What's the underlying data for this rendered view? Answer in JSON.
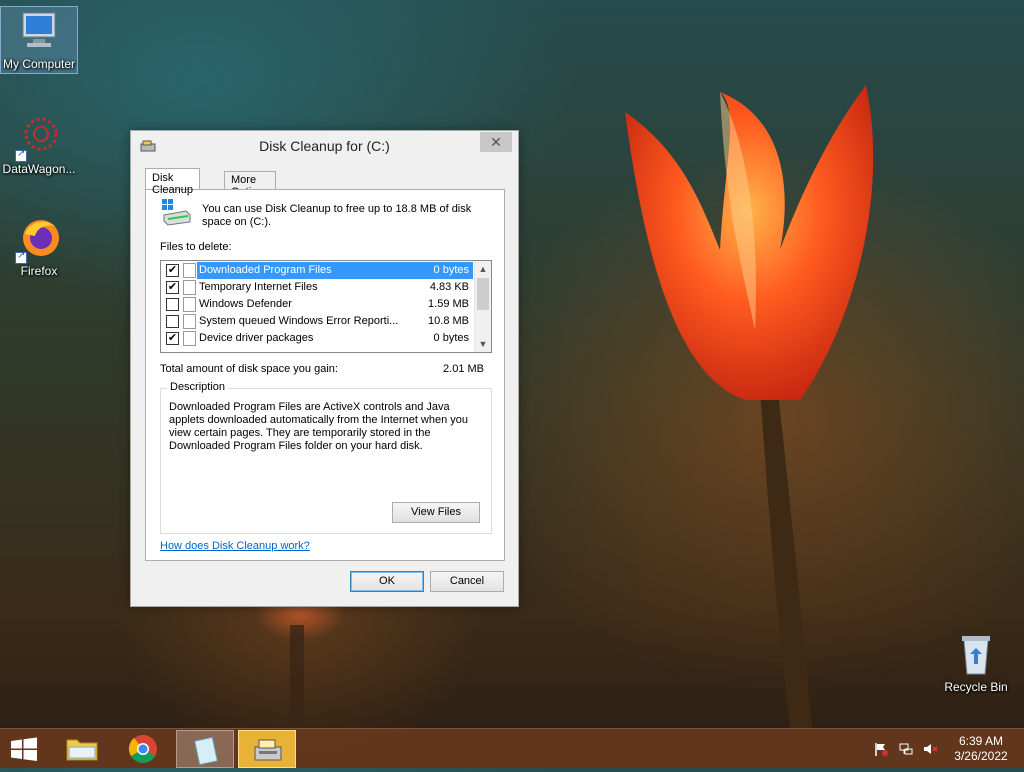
{
  "desktop": {
    "icons": [
      {
        "label": "My Computer"
      },
      {
        "label": "DataWagon..."
      },
      {
        "label": "Firefox"
      },
      {
        "label": "Recycle Bin"
      }
    ]
  },
  "dialog": {
    "title": "Disk Cleanup for  (C:)",
    "close_glyph": "✕",
    "tabs": [
      "Disk Cleanup",
      "More Options"
    ],
    "summary": "You can use Disk Cleanup to free up to 18.8 MB of disk space on  (C:).",
    "files_label": "Files to delete:",
    "files": [
      {
        "checked": true,
        "name": "Downloaded Program Files",
        "size": "0 bytes",
        "selected": true
      },
      {
        "checked": true,
        "name": "Temporary Internet Files",
        "size": "4.83 KB",
        "selected": false
      },
      {
        "checked": false,
        "name": "Windows Defender",
        "size": "1.59 MB",
        "selected": false
      },
      {
        "checked": false,
        "name": "System queued Windows Error Reporti...",
        "size": "10.8 MB",
        "selected": false
      },
      {
        "checked": true,
        "name": "Device driver packages",
        "size": "0 bytes",
        "selected": false
      }
    ],
    "gain_label": "Total amount of disk space you gain:",
    "gain_value": "2.01 MB",
    "description_legend": "Description",
    "description_text": "Downloaded Program Files are ActiveX controls and Java applets downloaded automatically from the Internet when you view certain pages. They are temporarily stored in the Downloaded Program Files folder on your hard disk.",
    "view_files_label": "View Files",
    "help_link": "How does Disk Cleanup work?",
    "ok_label": "OK",
    "cancel_label": "Cancel",
    "check_glyph": "✔"
  },
  "taskbar": {
    "clock_time": "6:39 AM",
    "clock_date": "3/26/2022",
    "accent": "#f5c842"
  }
}
